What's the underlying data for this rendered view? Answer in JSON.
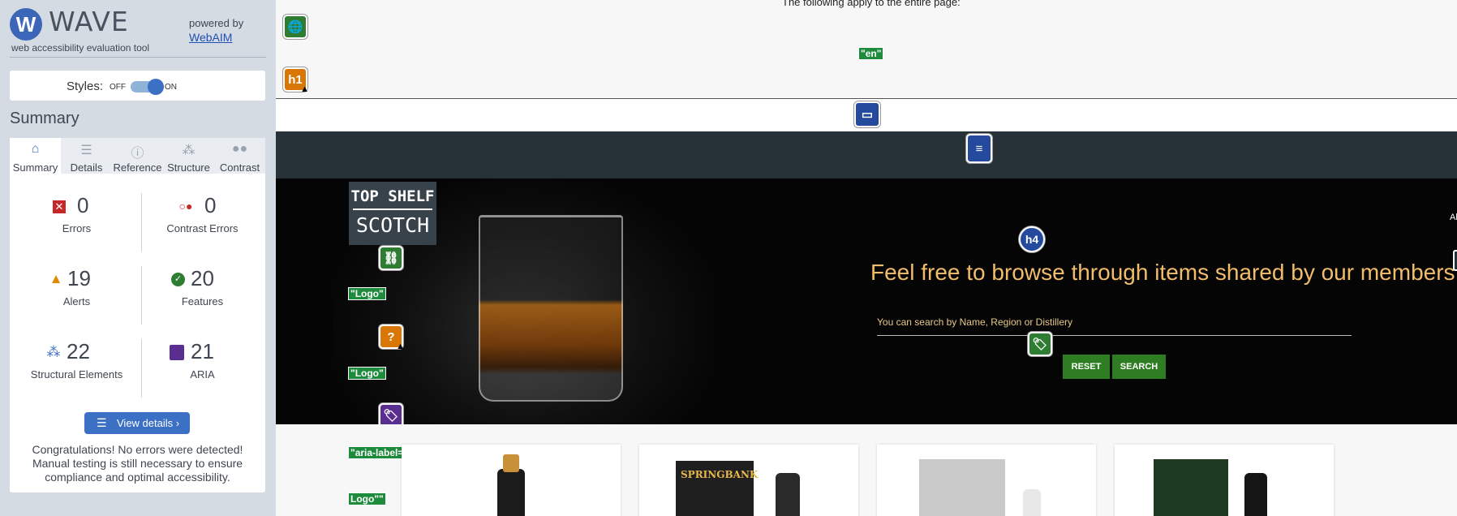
{
  "wave": {
    "logo_letter": "W",
    "name": "WAVE",
    "tagline": "web accessibility evaluation tool",
    "powered_by": "powered by",
    "webaim": "WebAIM",
    "styles_label": "Styles:",
    "off": "OFF",
    "on": "ON",
    "summary_title": "Summary",
    "tabs": [
      {
        "label": "Summary",
        "icon": "home-icon",
        "glyph": "⌂"
      },
      {
        "label": "Details",
        "icon": "list-icon",
        "glyph": "☰"
      },
      {
        "label": "Reference",
        "icon": "info-icon",
        "glyph": "ⓘ"
      },
      {
        "label": "Structure",
        "icon": "structure-icon",
        "glyph": "⁂"
      },
      {
        "label": "Contrast",
        "icon": "contrast-icon",
        "glyph": "●●"
      }
    ],
    "stats": {
      "errors": {
        "count": "0",
        "label": "Errors"
      },
      "contrast": {
        "count": "0",
        "label": "Contrast Errors"
      },
      "alerts": {
        "count": "19",
        "label": "Alerts"
      },
      "features": {
        "count": "20",
        "label": "Features"
      },
      "structural": {
        "count": "22",
        "label": "Structural Elements"
      },
      "aria": {
        "count": "21",
        "label": "ARIA"
      }
    },
    "view_details": "View details ›",
    "congrats": "Congratulations! No errors were detected! Manual testing is still necessary to ensure compliance and optimal accessibility."
  },
  "page": {
    "apply_text": "The following apply to the entire page:",
    "lang_tag": "\"en\"",
    "h1_icon": "h1",
    "h4_icon": "h4",
    "logo_top": "TOP SHELF",
    "logo_bottom": "SCOTCH",
    "tag_logo_1": "\"Logo\"",
    "tag_logo_2": "\"Logo\"",
    "tag_aria_label": "\"aria-label=\"Site",
    "tag_logo_3": "Logo\"\"",
    "hero_heading": "Feel free to browse through items shared by our members",
    "search_label": "You can search by Name, Region or Distillery",
    "reset": "RESET",
    "search": "SEARCH",
    "right_edge": "Al"
  }
}
